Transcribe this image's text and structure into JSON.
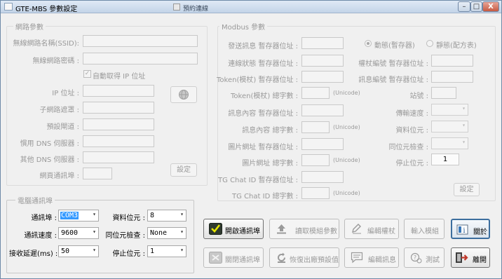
{
  "window": {
    "title": "GTE-MBS 參數設定",
    "second_tab": "預約連線",
    "controls": {
      "minimize": "–",
      "maximize": "□",
      "close": "X"
    }
  },
  "network": {
    "title": "網路參數",
    "ssid_label": "無線網路名稱(SSID):",
    "password_label": "無線網路密碼 :",
    "dhcp_label": "自動取得 IP 位址",
    "ip_label": "IP 位址 :",
    "mask_label": "子網路遮罩 :",
    "gateway_label": "預設閘道 :",
    "dns1_label": "慣用 DNS 伺服器 :",
    "dns2_label": "其他 DNS 伺服器 :",
    "port_label": "網頁通訊埠 :",
    "set_button": "設定"
  },
  "modbus": {
    "title": "Modbus 參數",
    "send_msg_addr": "發送訊息 暫存器位址 :",
    "conn_status_addr": "連線狀態 暫存器位址 :",
    "token_addr": "Token(模杖) 暫存器位址 :",
    "token_len": "Token(模杖) 總字數 :",
    "msg_content_addr": "訊息內容 暫存器位址 :",
    "msg_content_len": "訊息內容 總字數 :",
    "image_url_addr": "圖片網址 暫存器位址 :",
    "image_url_len": "圖片網址 總字數 :",
    "tg_chat_addr": "TG Chat ID 暫存器位址 :",
    "tg_chat_len": "TG Chat ID 總字數 :",
    "unicode": "(Unicode)",
    "radio_dynamic": "動態(暫存器)",
    "radio_static": "靜態(配方表)",
    "token_no_addr": "權杖編號 暫存器位址 :",
    "msg_no_addr": "訊息編號 暫存器位址 :",
    "station_label": "站號 :",
    "baud_label": "傳輸速度 :",
    "data_bits_label": "資料位元 :",
    "parity_label": "同位元檢查 :",
    "stop_bits_label": "停止位元 :",
    "stop_bits_value": "1",
    "set_button": "設定"
  },
  "serial": {
    "title": "電腦通訊埠",
    "port_label": "通訊埠 :",
    "port_value": "COM3",
    "baud_label": "通訊速度 :",
    "baud_value": "9600",
    "delay_label": "接收延遲(ms) :",
    "delay_value": "50",
    "data_bits_label": "資料位元 :",
    "data_bits_value": "8",
    "parity_label": "同位元檢查 :",
    "parity_value": "None",
    "stop_bits_label": "停止位元 :",
    "stop_bits_value": "1"
  },
  "actions": {
    "open_port": "開啟通訊埠",
    "read_params": "讀取模組參數",
    "edit_token": "編輯權杖",
    "import_module": "輸入模組",
    "about": "關於",
    "close_port": "關閉通訊埠",
    "restore_defaults": "恢復出廠預設值",
    "edit_message": "編輯訊息",
    "test": "測試",
    "exit": "離開"
  }
}
